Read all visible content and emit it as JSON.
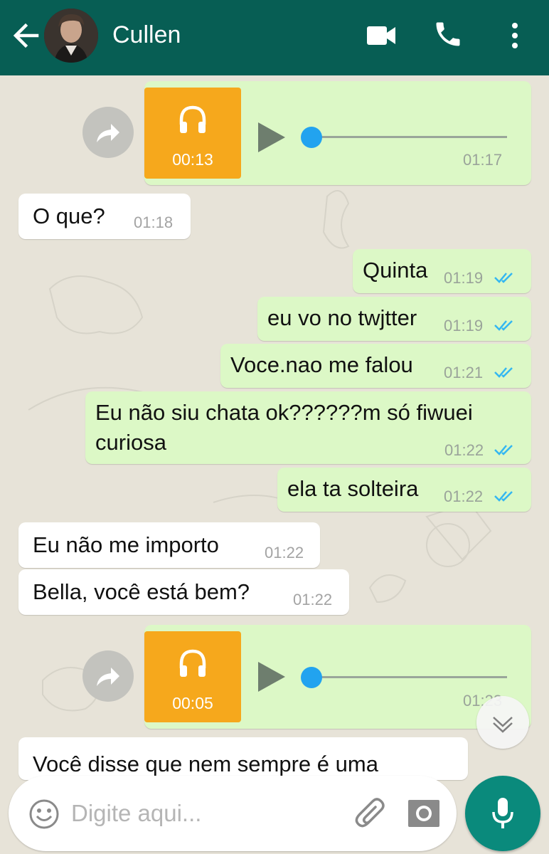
{
  "header": {
    "contact_name": "Cullen",
    "icons": [
      "back-arrow-icon",
      "video-call-icon",
      "phone-icon",
      "more-vert-icon"
    ],
    "bg_color": "#075e54"
  },
  "messages": [
    {
      "type": "audio",
      "direction": "out",
      "duration": "00:13",
      "time": "01:17"
    },
    {
      "type": "text",
      "direction": "in",
      "text": "O que?",
      "time": "01:18"
    },
    {
      "type": "text",
      "direction": "out",
      "text": "Quinta",
      "time": "01:19",
      "status": "read"
    },
    {
      "type": "text",
      "direction": "out",
      "text": "eu vo no twjtter",
      "time": "01:19",
      "status": "read"
    },
    {
      "type": "text",
      "direction": "out",
      "text": "Voce.nao me falou",
      "time": "01:21",
      "status": "read"
    },
    {
      "type": "text",
      "direction": "out",
      "text_line1": "Eu não siu chata ok??????m só fiwuei",
      "text_line2": "curiosa",
      "time": "01:22",
      "status": "read"
    },
    {
      "type": "text",
      "direction": "out",
      "text": "ela ta solteira",
      "time": "01:22",
      "status": "read"
    },
    {
      "type": "text",
      "direction": "in",
      "text": "Eu não me importo",
      "time": "01:22"
    },
    {
      "type": "text",
      "direction": "in",
      "text": "Bella, você está bem?",
      "time": "01:22"
    },
    {
      "type": "audio",
      "direction": "out",
      "duration": "00:05",
      "time": "01:23"
    },
    {
      "type": "text",
      "direction": "in",
      "text": "Você disse que nem sempre é uma",
      "partial": true
    }
  ],
  "input": {
    "placeholder": "Digite aqui..."
  },
  "colors": {
    "outgoing_bubble": "#dcf8c6",
    "incoming_bubble": "#ffffff",
    "read_ticks": "#34b7f1",
    "audio_thumb": "#f6a81c",
    "mic_button": "#0a8a7c"
  }
}
